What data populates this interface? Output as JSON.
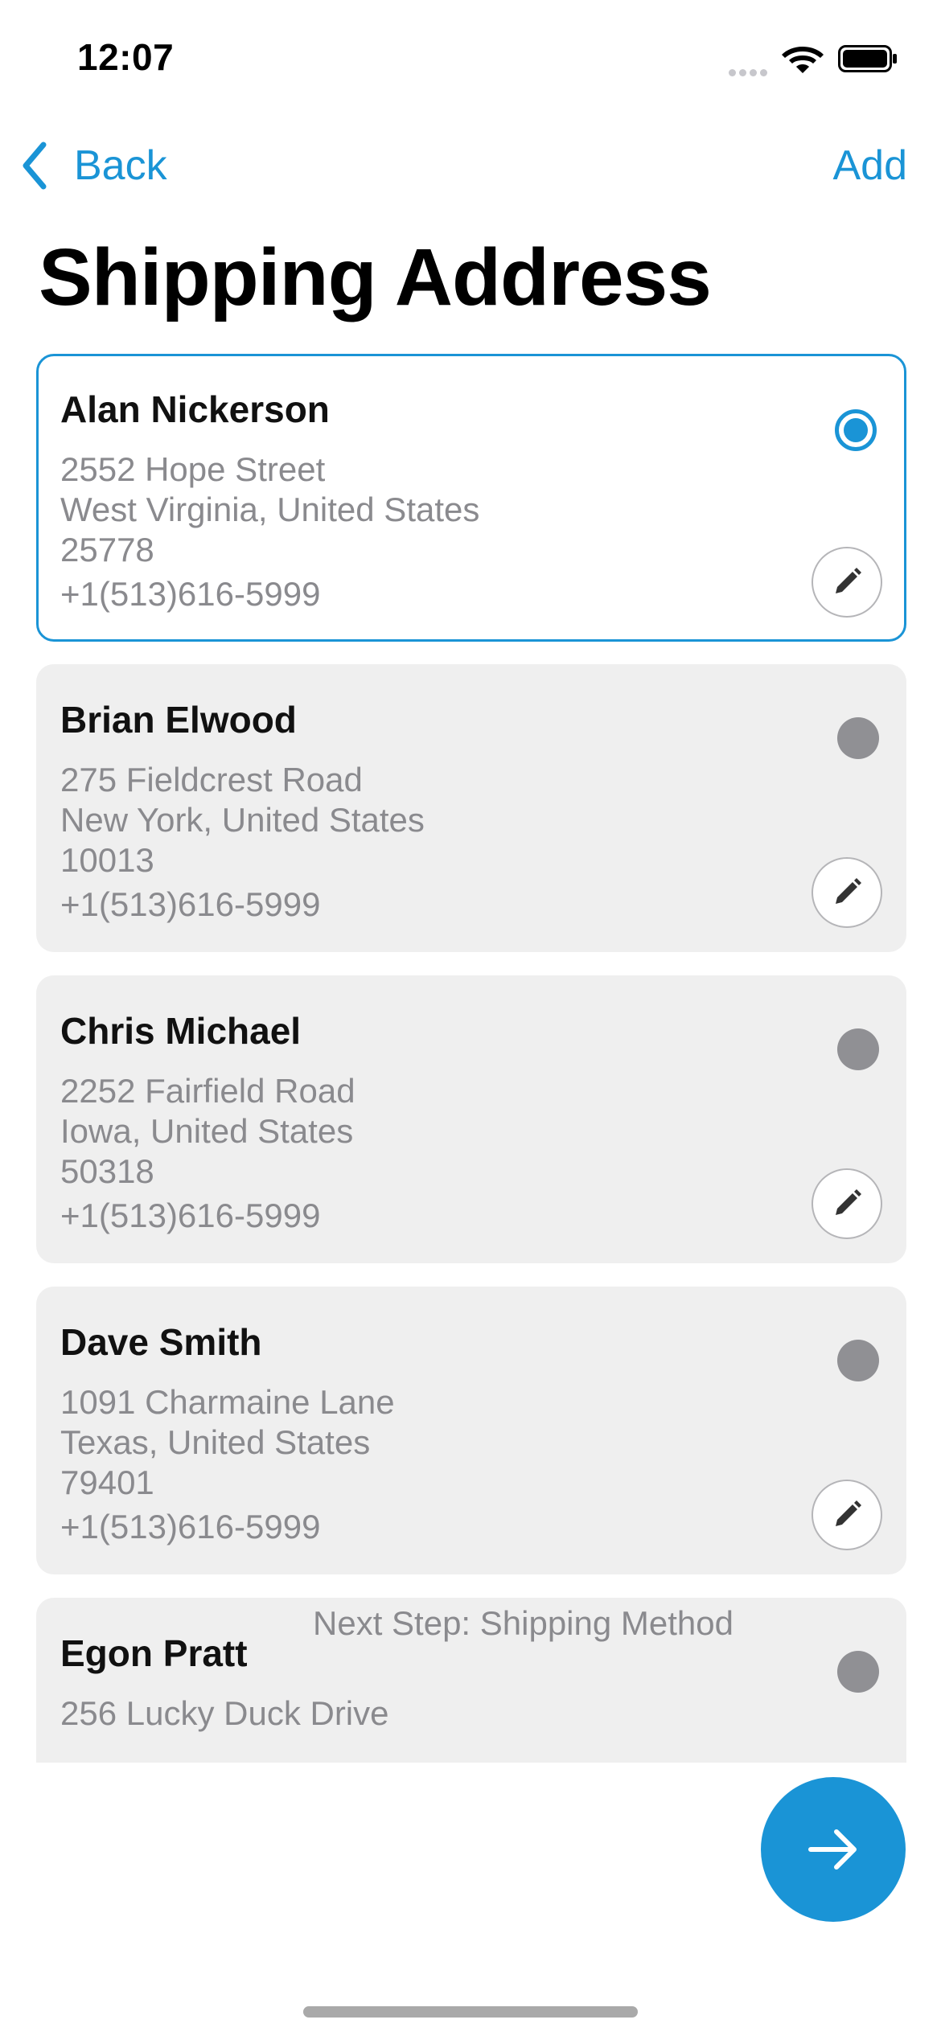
{
  "status_bar": {
    "time": "12:07",
    "icons": [
      "cellular-signal-icon",
      "wifi-icon",
      "battery-icon"
    ]
  },
  "nav": {
    "back_label": "Back",
    "add_label": "Add",
    "accent_color": "#1a94d6"
  },
  "page": {
    "title": "Shipping Address"
  },
  "addresses": [
    {
      "name": "Alan Nickerson",
      "street": "2552  Hope Street",
      "region": "West Virginia, United States",
      "zip": "25778",
      "phone": "+1(513)616-5999",
      "selected": true
    },
    {
      "name": "Brian Elwood",
      "street": "275  Fieldcrest Road",
      "region": "New York, United States",
      "zip": "10013",
      "phone": "+1(513)616-5999",
      "selected": false
    },
    {
      "name": "Chris Michael",
      "street": "2252  Fairfield Road",
      "region": "Iowa, United States",
      "zip": "50318",
      "phone": "+1(513)616-5999",
      "selected": false
    },
    {
      "name": "Dave Smith",
      "street": "1091  Charmaine Lane",
      "region": "Texas, United States",
      "zip": "79401",
      "phone": "+1(513)616-5999",
      "selected": false
    },
    {
      "name": "Egon Pratt",
      "street": "256  Lucky Duck Drive",
      "region": "",
      "zip": "",
      "phone": "",
      "selected": false
    }
  ],
  "footer": {
    "next_step_label": "Next Step: Shipping Method",
    "next_button_icon": "arrow-right-icon"
  }
}
